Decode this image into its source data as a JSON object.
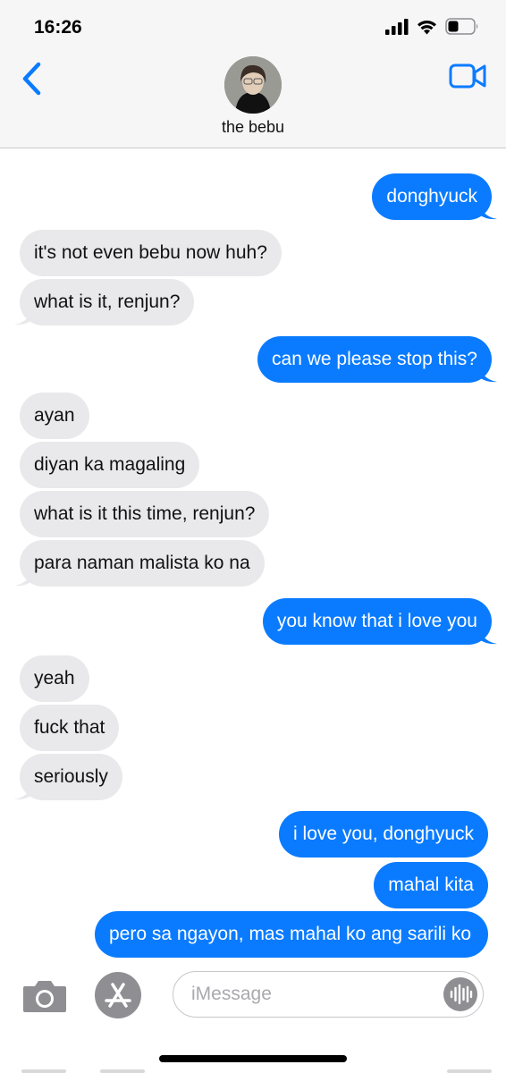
{
  "status_bar": {
    "time": "16:26"
  },
  "header": {
    "contact_name": "the bebu"
  },
  "messages": [
    {
      "from": "me",
      "text": "donghyuck"
    },
    {
      "from": "them",
      "text": "it's not even bebu now huh?"
    },
    {
      "from": "them",
      "text": "what is it, renjun?"
    },
    {
      "from": "me",
      "text": "can we please stop this?"
    },
    {
      "from": "them",
      "text": "ayan"
    },
    {
      "from": "them",
      "text": "diyan ka magaling"
    },
    {
      "from": "them",
      "text": "what is it this time, renjun?"
    },
    {
      "from": "them",
      "text": "para naman malista ko na"
    },
    {
      "from": "me",
      "text": "you know that i love you"
    },
    {
      "from": "them",
      "text": "yeah"
    },
    {
      "from": "them",
      "text": "fuck that"
    },
    {
      "from": "them",
      "text": "seriously"
    },
    {
      "from": "me",
      "text": "i love you, donghyuck"
    },
    {
      "from": "me",
      "text": "mahal kita"
    },
    {
      "from": "me",
      "text": "pero sa ngayon, mas mahal ko ang sarili ko"
    }
  ],
  "composer": {
    "placeholder": "iMessage"
  },
  "colors": {
    "sent_bubble": "#0a7bff",
    "received_bubble": "#e9e9eb",
    "accent": "#0a7bff"
  },
  "icons": [
    "back-chevron-icon",
    "video-call-icon",
    "camera-icon",
    "app-store-icon",
    "audio-wave-icon",
    "signal-icon",
    "wifi-icon",
    "battery-icon"
  ]
}
